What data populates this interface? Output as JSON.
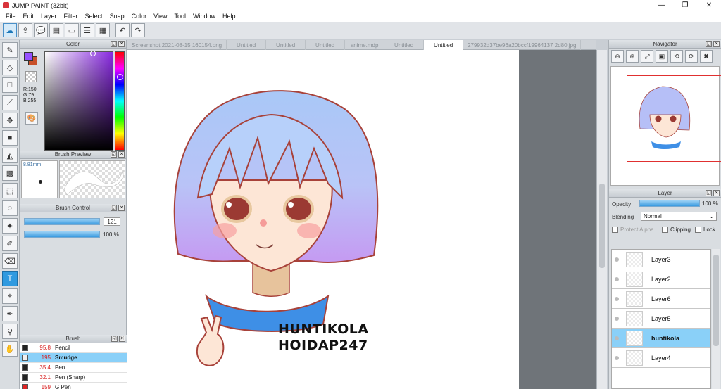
{
  "window": {
    "title": "JUMP PAINT (32bit)",
    "min": "—",
    "restore": "❐",
    "close": "✕"
  },
  "menu": [
    "File",
    "Edit",
    "Layer",
    "Filter",
    "Select",
    "Snap",
    "Color",
    "View",
    "Tool",
    "Window",
    "Help"
  ],
  "colors": {
    "primary": "#9650ff",
    "secondary": "#c8502a",
    "accent": "#3a9be0",
    "selected_row": "#8ad0f8"
  },
  "color_panel": {
    "title": "Color",
    "r": "R:150",
    "g": "G:79",
    "b": "B:255"
  },
  "brush_preview": {
    "title": "Brush Preview",
    "size": "8.81mm"
  },
  "brush_control": {
    "title": "Brush Control",
    "size_value": "121",
    "opacity_value": "100 %"
  },
  "brush_list": {
    "title": "Brush",
    "items": [
      {
        "size": "95.8",
        "name": "Pencil",
        "color": "#222222",
        "selected": false
      },
      {
        "size": "195",
        "name": "Smudge",
        "color": "#f0f0f0",
        "selected": true
      },
      {
        "size": "35.4",
        "name": "Pen",
        "color": "#222222",
        "selected": false
      },
      {
        "size": "32.1",
        "name": "Pen (Sharp)",
        "color": "#222222",
        "selected": false
      },
      {
        "size": "159",
        "name": "G Pen",
        "color": "#e02424",
        "selected": false
      }
    ]
  },
  "tabs": [
    {
      "label": "Screenshot 2021-08-15 160154.png",
      "active": false
    },
    {
      "label": "Untitled",
      "active": false
    },
    {
      "label": "Untitled",
      "active": false
    },
    {
      "label": "Untitled",
      "active": false
    },
    {
      "label": "anime.mdp",
      "active": false
    },
    {
      "label": "Untitled",
      "active": false
    },
    {
      "label": "Untitled",
      "active": true
    },
    {
      "label": "279932d37be96a20bccf19964137 2d80.jpg",
      "active": false
    }
  ],
  "artwork": {
    "text_line1": "HUNTIKOLA",
    "text_line2": "HOIDAP247"
  },
  "navigator": {
    "title": "Navigator"
  },
  "layer_panel": {
    "title": "Layer",
    "opacity_label": "Opacity",
    "opacity_value": "100 %",
    "blending_label": "Blending",
    "blending_value": "Normal",
    "protect_alpha": "Protect Alpha",
    "clipping": "Clipping",
    "lock": "Lock"
  },
  "layers": [
    {
      "name": "Layer3",
      "selected": false
    },
    {
      "name": "Layer2",
      "selected": false
    },
    {
      "name": "Layer6",
      "selected": false
    },
    {
      "name": "Layer5",
      "selected": false
    },
    {
      "name": "huntikola",
      "selected": true
    },
    {
      "name": "Layer4",
      "selected": false
    }
  ],
  "toolbar_icons": [
    "cloud-icon",
    "export-icon",
    "comment-icon",
    "material-icon",
    "page-icon",
    "list-icon",
    "grid-icon",
    "undo-icon",
    "redo-icon"
  ],
  "tools": [
    "brush-icon",
    "eraser-icon",
    "rect-select-icon",
    "brush-alt-icon",
    "move-icon",
    "fill-rect-icon",
    "bucket-icon",
    "gradient-icon",
    "select-icon",
    "lasso-icon",
    "magic-wand-icon",
    "select-pen-icon",
    "select-eraser-icon",
    "text-icon",
    "transform-icon",
    "pen-icon",
    "dropper-icon",
    "hand-icon"
  ]
}
